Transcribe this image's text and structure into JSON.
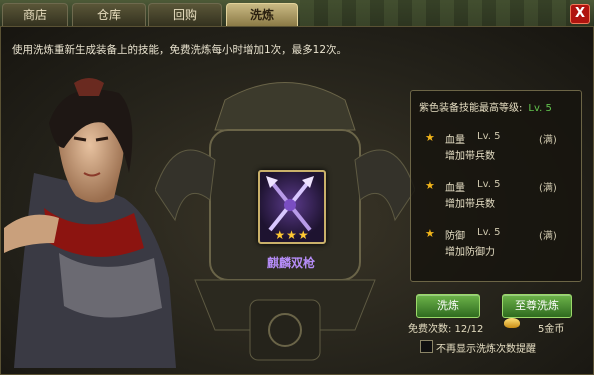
{
  "tabs": [
    "商店",
    "仓库",
    "回购",
    "洗炼"
  ],
  "active_tab": "洗炼",
  "close_label": "X",
  "description": "使用洗炼重新生成装备上的技能，免费洗炼每小时增加1次，最多12次。",
  "item": {
    "name": "麒麟双枪",
    "stars": "★★★",
    "quality_color": "#b58cf6"
  },
  "info": {
    "title": "紫色装备技能最高等级:",
    "max_level": "Lv. 5",
    "skills": [
      {
        "name": "血量",
        "level": "Lv. 5",
        "full": "(满)",
        "effect": "增加带兵数"
      },
      {
        "name": "血量",
        "level": "Lv. 5",
        "full": "(满)",
        "effect": "增加带兵数"
      },
      {
        "name": "防御",
        "level": "Lv. 5",
        "full": "(满)",
        "effect": "增加防御力"
      }
    ]
  },
  "buttons": {
    "refine": "洗炼",
    "supreme_refine": "至尊洗炼"
  },
  "free_count": "免费次数: 12/12",
  "cost": "5金币",
  "checkbox_label": "不再显示洗炼次数提醒",
  "colors": {
    "accent_green": "#62c44d",
    "button_green": "#4e9a33",
    "close_red": "#b0140f"
  },
  "icons": [
    "close-icon",
    "star-icon",
    "gold-ingot-icon",
    "dual-spear-icon"
  ]
}
